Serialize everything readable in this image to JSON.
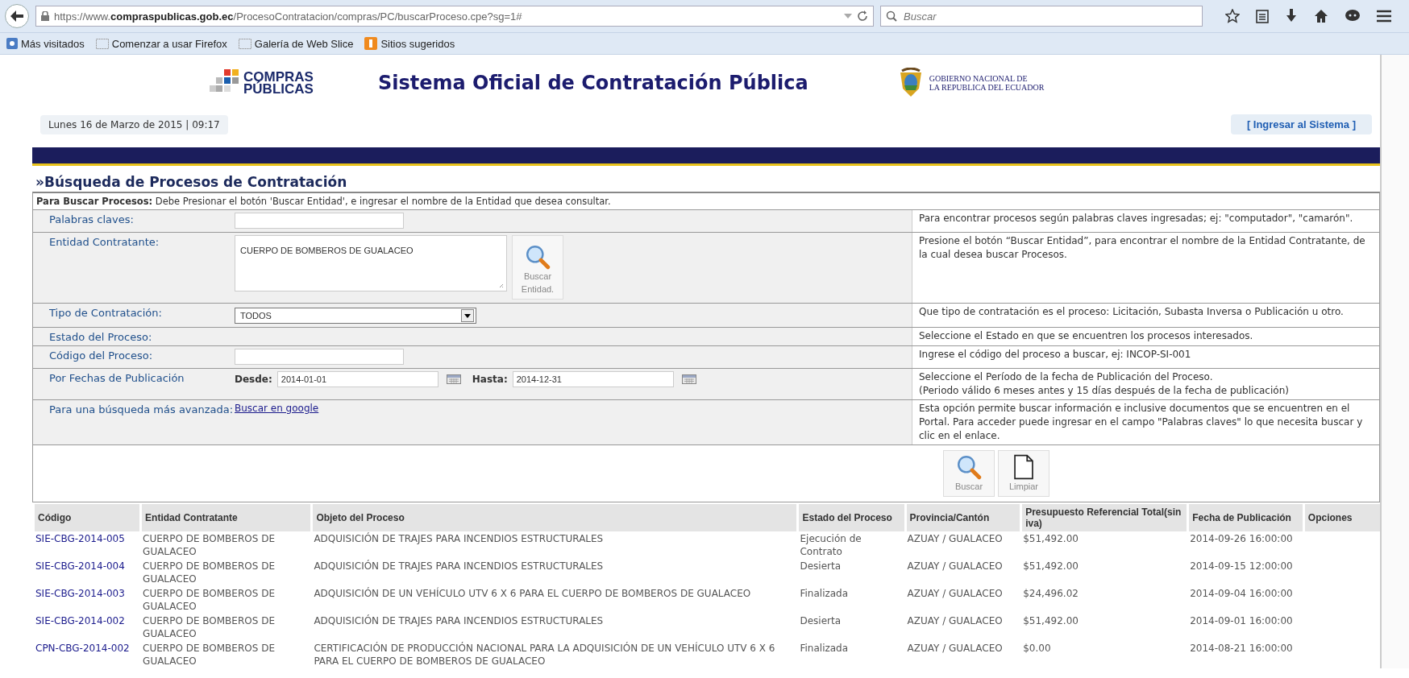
{
  "browser": {
    "url": "https://www.**compraspublicas.gob.ec**/ProcesoContratacion/compras/PC/buscarProceso.cpe?sg=1#",
    "search_placeholder": "Buscar",
    "bookmarks": [
      {
        "label": "Más visitados",
        "kind": "app"
      },
      {
        "label": "Comenzar a usar Firefox",
        "kind": "folder"
      },
      {
        "label": "Galería de Web Slice",
        "kind": "folder"
      },
      {
        "label": "Sitios sugeridos",
        "kind": "suggest"
      }
    ]
  },
  "header": {
    "logo_lines": [
      "COMPRAS",
      "PÚBLICAS"
    ],
    "title": "Sistema Oficial de Contratación Pública",
    "gov_lines": [
      "GOBIERNO NACIONAL DE",
      "LA REPUBLICA DEL ECUADOR"
    ],
    "date": "Lunes 16 de Marzo de 2015 | 09:17",
    "login_link": "[ Ingresar al Sistema ]"
  },
  "search": {
    "title": "»Búsqueda de Procesos de Contratación",
    "instructions": "**Para Buscar Procesos:** Debe Presionar el botón 'Buscar Entidad', e ingresar el nombre de la Entidad que desea consultar.",
    "rows": [
      {
        "kind": "text",
        "label": "Palabras claves:",
        "help": "Para encontrar procesos según palabras claves ingresadas; ej: \"computador\", \"camarón\"."
      },
      {
        "kind": "textarea",
        "label": "Entidad Contratante:",
        "value": "CUERPO DE BOMBEROS DE GUALACEO",
        "button": "Buscar Entidad.",
        "help": "Presione el botón “Buscar Entidad”, para encontrar el nombre de la Entidad Contratante, de la cual desea buscar Procesos."
      },
      {
        "kind": "select",
        "label": "Tipo de Contratación:",
        "value": "TODOS",
        "help": "Que tipo de contratación es el proceso: Licitación, Subasta Inversa o Publicación u otro."
      },
      {
        "kind": "empty",
        "label": "Estado del Proceso:",
        "help": "Seleccione el Estado en que se encuentren los procesos interesados."
      },
      {
        "kind": "text",
        "label": "Código del Proceso:",
        "help": "Ingrese el código del proceso a buscar, ej: INCOP-SI-001"
      },
      {
        "kind": "dates",
        "label": "Por Fechas de Publicación",
        "from_label": "Desde:",
        "from": "2014-01-01",
        "to_label": "Hasta:",
        "to": "2014-12-31",
        "help": "Seleccione el Período de la fecha de Publicación del Proceso.\n(Periodo válido 6 meses antes y 15 días después de la fecha de publicación)"
      },
      {
        "kind": "link",
        "label": "Para una búsqueda más avanzada:",
        "link": "Buscar en google",
        "help": "Esta opción permite buscar información e inclusive documentos que se encuentren en el Portal. Para acceder puede ingresar en el campo \"Palabras claves\" lo que necesita buscar y clic en el enlace."
      }
    ],
    "buttons": [
      {
        "kind": "search",
        "label": "Buscar"
      },
      {
        "kind": "clear",
        "label": "Limpiar"
      }
    ]
  },
  "table": {
    "columns": [
      "Código",
      "Entidad Contratante",
      "Objeto del Proceso",
      "Estado del Proceso",
      "Provincia/Cantón",
      "Presupuesto Referencial Total(sin iva)",
      "Fecha de Publicación",
      "Opciones"
    ],
    "rows": [
      [
        "SIE-CBG-2014-005",
        "CUERPO DE BOMBEROS DE GUALACEO",
        "ADQUISICIÓN DE TRAJES PARA INCENDIOS ESTRUCTURALES",
        "Ejecución de Contrato",
        "AZUAY / GUALACEO",
        "$51,492.00",
        "2014-09-26 16:00:00"
      ],
      [
        "SIE-CBG-2014-004",
        "CUERPO DE BOMBEROS DE GUALACEO",
        "ADQUISICIÓN DE TRAJES PARA INCENDIOS ESTRUCTURALES",
        "Desierta",
        "AZUAY / GUALACEO",
        "$51,492.00",
        "2014-09-15 12:00:00"
      ],
      [
        "SIE-CBG-2014-003",
        "CUERPO DE BOMBEROS DE GUALACEO",
        "ADQUISICIÓN DE UN VEHÍCULO UTV 6 X 6 PARA EL CUERPO DE BOMBEROS DE GUALACEO",
        "Finalizada",
        "AZUAY / GUALACEO",
        "$24,496.02",
        "2014-09-04 16:00:00"
      ],
      [
        "SIE-CBG-2014-002",
        "CUERPO DE BOMBEROS DE GUALACEO",
        "ADQUISICIÓN DE TRAJES PARA INCENDIOS ESTRUCTURALES",
        "Desierta",
        "AZUAY / GUALACEO",
        "$51,492.00",
        "2014-09-01 16:00:00"
      ],
      [
        "CPN-CBG-2014-002",
        "CUERPO DE BOMBEROS DE GUALACEO",
        "CERTIFICACIÓN DE PRODUCCIÓN NACIONAL PARA LA ADQUISICIÓN DE UN VEHÍCULO UTV 6 X 6 PARA EL CUERPO DE BOMBEROS DE GUALACEO",
        "Finalizada",
        "AZUAY / GUALACEO",
        "$0.00",
        "2014-08-21 16:00:00"
      ]
    ]
  }
}
